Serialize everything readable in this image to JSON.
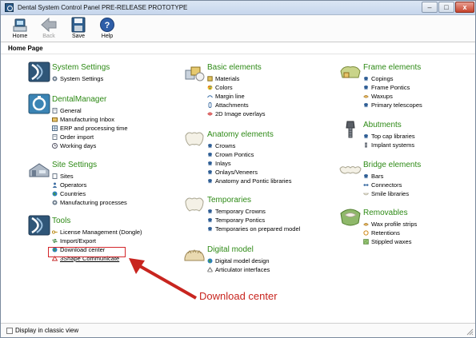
{
  "window": {
    "title": "Dental System Control Panel PRE-RELEASE PROTOTYPE",
    "minimize_label": "–",
    "maximize_label": "□",
    "close_label": "x"
  },
  "toolbar": {
    "home_label": "Home",
    "back_label": "Back",
    "save_label": "Save",
    "help_label": "Help"
  },
  "page": {
    "title": "Home Page"
  },
  "columns": {
    "system_settings": {
      "title": "System Settings",
      "items": [
        {
          "label": "System Settings",
          "icon": "gear-icon"
        }
      ]
    },
    "dental_manager": {
      "title": "DentalManager",
      "items": [
        {
          "label": "General",
          "icon": "document-icon"
        },
        {
          "label": "Manufacturing Inbox",
          "icon": "inbox-icon"
        },
        {
          "label": "ERP and processing time",
          "icon": "grid-icon"
        },
        {
          "label": "Order import",
          "icon": "document-icon"
        },
        {
          "label": "Working days",
          "icon": "clock-icon"
        }
      ]
    },
    "site_settings": {
      "title": "Site Settings",
      "items": [
        {
          "label": "Sites",
          "icon": "document-icon"
        },
        {
          "label": "Operators",
          "icon": "person-icon"
        },
        {
          "label": "Countries",
          "icon": "globe-icon"
        },
        {
          "label": "Manufacturing processes",
          "icon": "gear-icon"
        }
      ]
    },
    "tools": {
      "title": "Tools",
      "items": [
        {
          "label": "License Management (Dongle)",
          "icon": "key-icon"
        },
        {
          "label": "Import/Export",
          "icon": "arrows-icon"
        },
        {
          "label": "Download center",
          "icon": "globe-icon"
        },
        {
          "label": "3Shape Communicate",
          "icon": "communicate-icon"
        }
      ]
    },
    "basic_elements": {
      "title": "Basic elements",
      "items": [
        {
          "label": "Materials",
          "icon": "cube-icon"
        },
        {
          "label": "Colors",
          "icon": "palette-icon"
        },
        {
          "label": "Margin line",
          "icon": "line-icon"
        },
        {
          "label": "Attachments",
          "icon": "clip-icon"
        },
        {
          "label": "2D Image overlays",
          "icon": "overlay-icon"
        }
      ]
    },
    "anatomy_elements": {
      "title": "Anatomy elements",
      "items": [
        {
          "label": "Crowns",
          "icon": "tooth-icon"
        },
        {
          "label": "Crown Pontics",
          "icon": "tooth-icon"
        },
        {
          "label": "Inlays",
          "icon": "tooth-icon"
        },
        {
          "label": "Onlays/Veneers",
          "icon": "tooth-icon"
        },
        {
          "label": "Anatomy and Pontic libraries",
          "icon": "tooth-icon"
        }
      ]
    },
    "temporaries": {
      "title": "Temporaries",
      "items": [
        {
          "label": "Temporary Crowns",
          "icon": "tooth-icon"
        },
        {
          "label": "Temporary Pontics",
          "icon": "tooth-icon"
        },
        {
          "label": "Temporaries on prepared model",
          "icon": "tooth-icon"
        }
      ]
    },
    "digital_model": {
      "title": "Digital model",
      "items": [
        {
          "label": "Digital model design",
          "icon": "globe-icon"
        },
        {
          "label": "Articulator interfaces",
          "icon": "articulator-icon"
        }
      ]
    },
    "frame_elements": {
      "title": "Frame elements",
      "items": [
        {
          "label": "Copings",
          "icon": "tooth-icon"
        },
        {
          "label": "Frame Pontics",
          "icon": "tooth-icon"
        },
        {
          "label": "Waxups",
          "icon": "wax-icon"
        },
        {
          "label": "Primary telescopes",
          "icon": "tooth-icon"
        }
      ]
    },
    "abutments": {
      "title": "Abutments",
      "items": [
        {
          "label": "Top cap libraries",
          "icon": "tooth-icon"
        },
        {
          "label": "Implant systems",
          "icon": "implant-icon"
        }
      ]
    },
    "bridge_elements": {
      "title": "Bridge elements",
      "items": [
        {
          "label": "Bars",
          "icon": "tooth-icon"
        },
        {
          "label": "Connectors",
          "icon": "connector-icon"
        },
        {
          "label": "Smile libraries",
          "icon": "smile-icon"
        }
      ]
    },
    "removables": {
      "title": "Removables",
      "items": [
        {
          "label": "Wax profile strips",
          "icon": "wax-icon"
        },
        {
          "label": "Retentions",
          "icon": "retention-icon"
        },
        {
          "label": "Stippled waxes",
          "icon": "stipple-icon"
        }
      ]
    }
  },
  "annotation": {
    "callout_text": "Download center",
    "color": "#c8251f"
  },
  "footer": {
    "classic_view_label": "Display in classic view",
    "classic_view_checked": false
  },
  "colors": {
    "section_title": "#2e8a16",
    "link_text": "#000000",
    "highlight": "#d3262a"
  }
}
